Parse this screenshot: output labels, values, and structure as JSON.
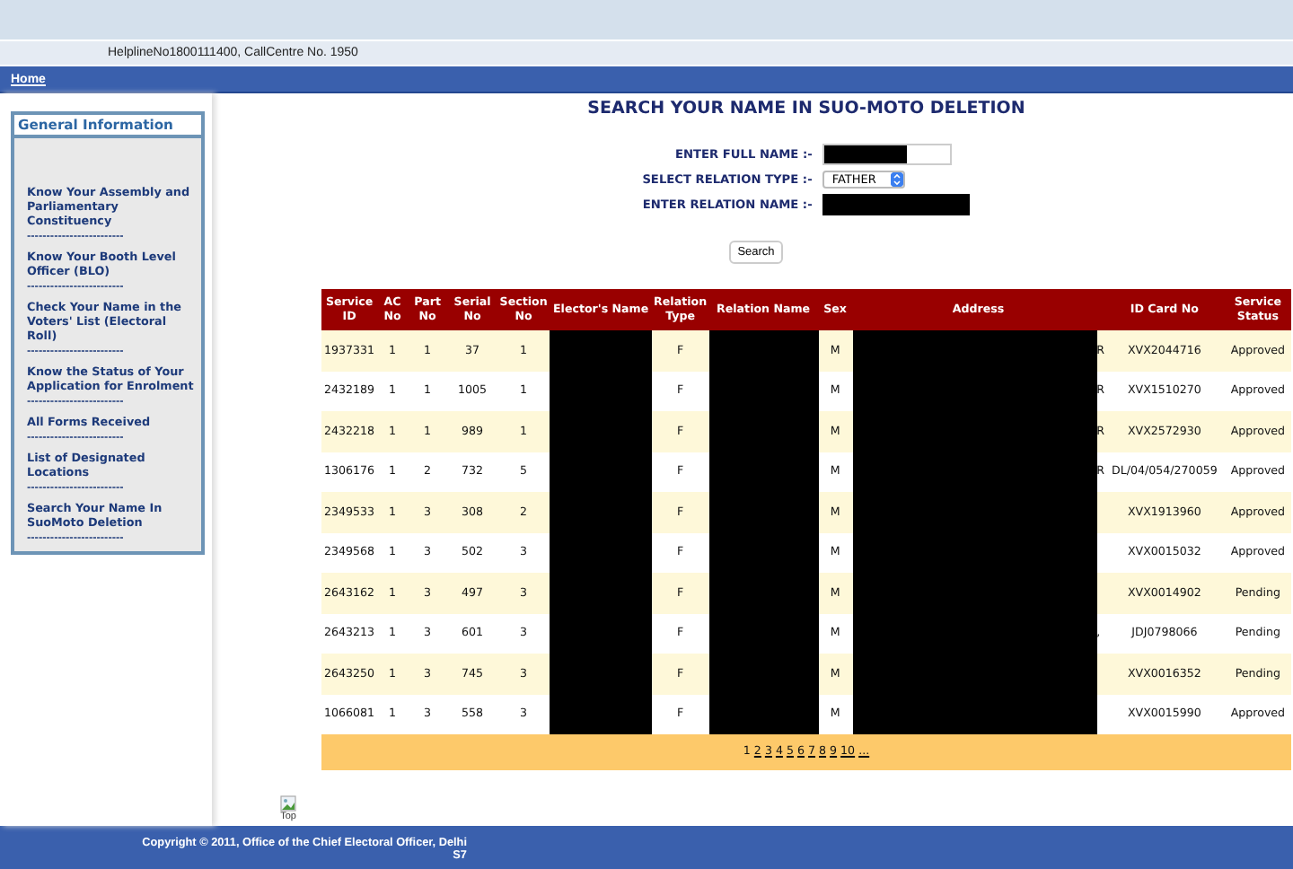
{
  "header": {
    "helpline": "HelplineNo1800111400, CallCentre No. 1950"
  },
  "nav": {
    "items": [
      {
        "label": "Home"
      }
    ]
  },
  "sidebar": {
    "title": "General Information",
    "items": [
      {
        "label": "Know Your Assembly and Parliamentary Constituency",
        "separator": "-------------------------"
      },
      {
        "label": "Know Your Booth Level Officer (BLO)",
        "separator": "-------------------------"
      },
      {
        "label": "Check Your Name in the Voters' List (Electoral Roll)",
        "separator": "-------------------------"
      },
      {
        "label": "Know the Status of Your Application for Enrolment",
        "separator": "-------------------------"
      },
      {
        "label": "All Forms Received",
        "separator": "-------------------------"
      },
      {
        "label": "List of Designated Locations",
        "separator": "-------------------------"
      },
      {
        "label": "Search Your Name In SuoMoto Deletion",
        "separator": "-------------------------"
      }
    ]
  },
  "form": {
    "title": "SEARCH YOUR NAME IN SUO-MOTO DELETION",
    "fields": [
      {
        "label": "ENTER FULL NAME :-",
        "kind": "text",
        "redacted": true
      },
      {
        "label": "SELECT RELATION TYPE :-",
        "kind": "select",
        "value": "FATHER"
      },
      {
        "label": "ENTER RELATION NAME :-",
        "kind": "text",
        "redacted": true
      }
    ],
    "button": "Search"
  },
  "table": {
    "columns": [
      {
        "label": "Service ID",
        "kind": "text"
      },
      {
        "label": "AC No",
        "kind": "text"
      },
      {
        "label": "Part No",
        "kind": "text"
      },
      {
        "label": "Serial No",
        "kind": "text"
      },
      {
        "label": "Section No",
        "kind": "text"
      },
      {
        "label": "Elector's Name",
        "kind": "redacted"
      },
      {
        "label": "Relation Type",
        "kind": "text"
      },
      {
        "label": "Relation Name",
        "kind": "redacted"
      },
      {
        "label": "Sex",
        "kind": "text"
      },
      {
        "label": "Address",
        "kind": "redacted_tail"
      },
      {
        "label": "ID Card No",
        "kind": "text"
      },
      {
        "label": "Service Status",
        "kind": "text"
      }
    ],
    "rows": [
      {
        "cells": [
          "1937331",
          "1",
          "1",
          "37",
          "1",
          null,
          "F",
          null,
          "M",
          "R",
          "XVX2044716",
          "Approved"
        ]
      },
      {
        "cells": [
          "2432189",
          "1",
          "1",
          "1005",
          "1",
          null,
          "F",
          null,
          "M",
          "R",
          "XVX1510270",
          "Approved"
        ]
      },
      {
        "cells": [
          "2432218",
          "1",
          "1",
          "989",
          "1",
          null,
          "F",
          null,
          "M",
          "R",
          "XVX2572930",
          "Approved"
        ]
      },
      {
        "cells": [
          "1306176",
          "1",
          "2",
          "732",
          "5",
          null,
          "F",
          null,
          "M",
          "R",
          "DL/04/054/270059",
          "Approved"
        ]
      },
      {
        "cells": [
          "2349533",
          "1",
          "3",
          "308",
          "2",
          null,
          "F",
          null,
          "M",
          null,
          "XVX1913960",
          "Approved"
        ]
      },
      {
        "cells": [
          "2349568",
          "1",
          "3",
          "502",
          "3",
          null,
          "F",
          null,
          "M",
          null,
          "XVX0015032",
          "Approved"
        ]
      },
      {
        "cells": [
          "2643162",
          "1",
          "3",
          "497",
          "3",
          null,
          "F",
          null,
          "M",
          null,
          "XVX0014902",
          "Pending"
        ]
      },
      {
        "cells": [
          "2643213",
          "1",
          "3",
          "601",
          "3",
          null,
          "F",
          null,
          "M",
          ",",
          "JDJ0798066",
          "Pending"
        ]
      },
      {
        "cells": [
          "2643250",
          "1",
          "3",
          "745",
          "3",
          null,
          "F",
          null,
          "M",
          null,
          "XVX0016352",
          "Pending"
        ]
      },
      {
        "cells": [
          "1066081",
          "1",
          "3",
          "558",
          "3",
          null,
          "F",
          null,
          "M",
          null,
          "XVX0015990",
          "Approved"
        ]
      }
    ],
    "pages": [
      {
        "label": "1",
        "selected": true
      },
      {
        "label": "2",
        "selected": false
      },
      {
        "label": "3",
        "selected": false
      },
      {
        "label": "4",
        "selected": false
      },
      {
        "label": "5",
        "selected": false
      },
      {
        "label": "6",
        "selected": false
      },
      {
        "label": "7",
        "selected": false
      },
      {
        "label": "8",
        "selected": false
      },
      {
        "label": "9",
        "selected": false
      },
      {
        "label": "10",
        "selected": false
      },
      {
        "label": "...",
        "selected": false
      }
    ]
  },
  "top_link": "Top",
  "footer": {
    "lines": [
      "Copyright © 2011, Office of the Chief Electoral Officer, Delhi",
      "S7"
    ]
  }
}
